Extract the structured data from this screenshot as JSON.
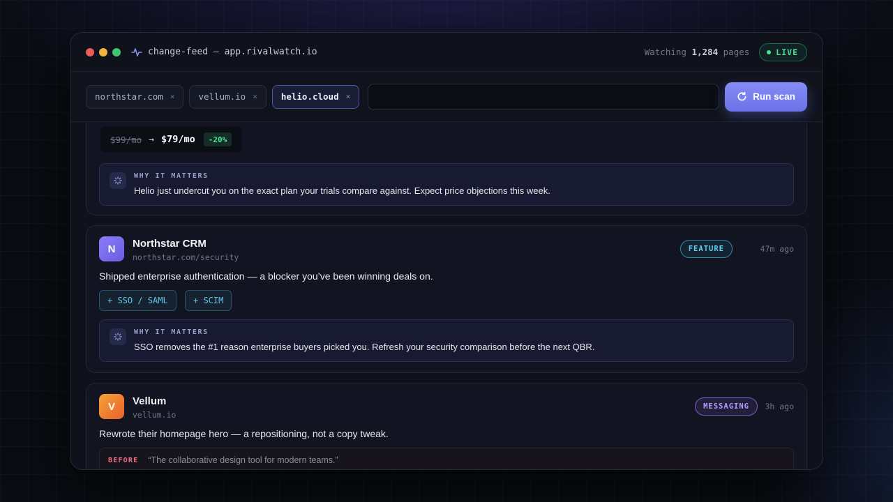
{
  "titlebar": {
    "title": "change-feed — app.rivalwatch.io",
    "watching_prefix": "Watching",
    "watching_count": "1,284",
    "watching_suffix": "pages",
    "live_label": "LIVE"
  },
  "toolbar": {
    "chips": [
      {
        "label": "northstar.com",
        "close": "×"
      },
      {
        "label": "vellum.io",
        "close": "×"
      },
      {
        "label": "helio.cloud",
        "close": "×"
      }
    ],
    "input_value": "",
    "input_placeholder": "",
    "scan_label": "Run scan"
  },
  "feed": {
    "card1": {
      "old_price": "$99/mo",
      "arrow": "→",
      "new_price": "$79/mo",
      "change": "-20%",
      "why_label": "WHY IT MATTERS",
      "why_text": "Helio just undercut you on the exact plan your trials compare against. Expect price objections this week."
    },
    "card2": {
      "avatar_letter": "N",
      "company": "Northstar CRM",
      "url": "northstar.com/security",
      "tag": "FEATURE",
      "time": "47m ago",
      "summary": "Shipped enterprise authentication — a blocker you’ve been winning deals on.",
      "added": [
        "+ SSO / SAML",
        "+ SCIM"
      ],
      "why_label": "WHY IT MATTERS",
      "why_text": "SSO removes the #1 reason enterprise buyers picked you. Refresh your security comparison before the next QBR."
    },
    "card3": {
      "avatar_letter": "V",
      "company": "Vellum",
      "url": "vellum.io",
      "tag": "MESSAGING",
      "time": "3h ago",
      "summary": "Rewrote their homepage hero — a repositioning, not a copy tweak.",
      "before_label": "BEFORE",
      "before_text": "“The collaborative design tool for modern teams.”"
    }
  },
  "colors": {
    "accent": "#6b72e8",
    "live": "#4ee29a",
    "feature": "#5fd0f0",
    "messaging": "#b69bff",
    "before": "#f06f85"
  },
  "icons": {
    "title": "activity-pulse-icon",
    "scan": "refresh-icon",
    "why": "sparkle-loader-icon"
  }
}
